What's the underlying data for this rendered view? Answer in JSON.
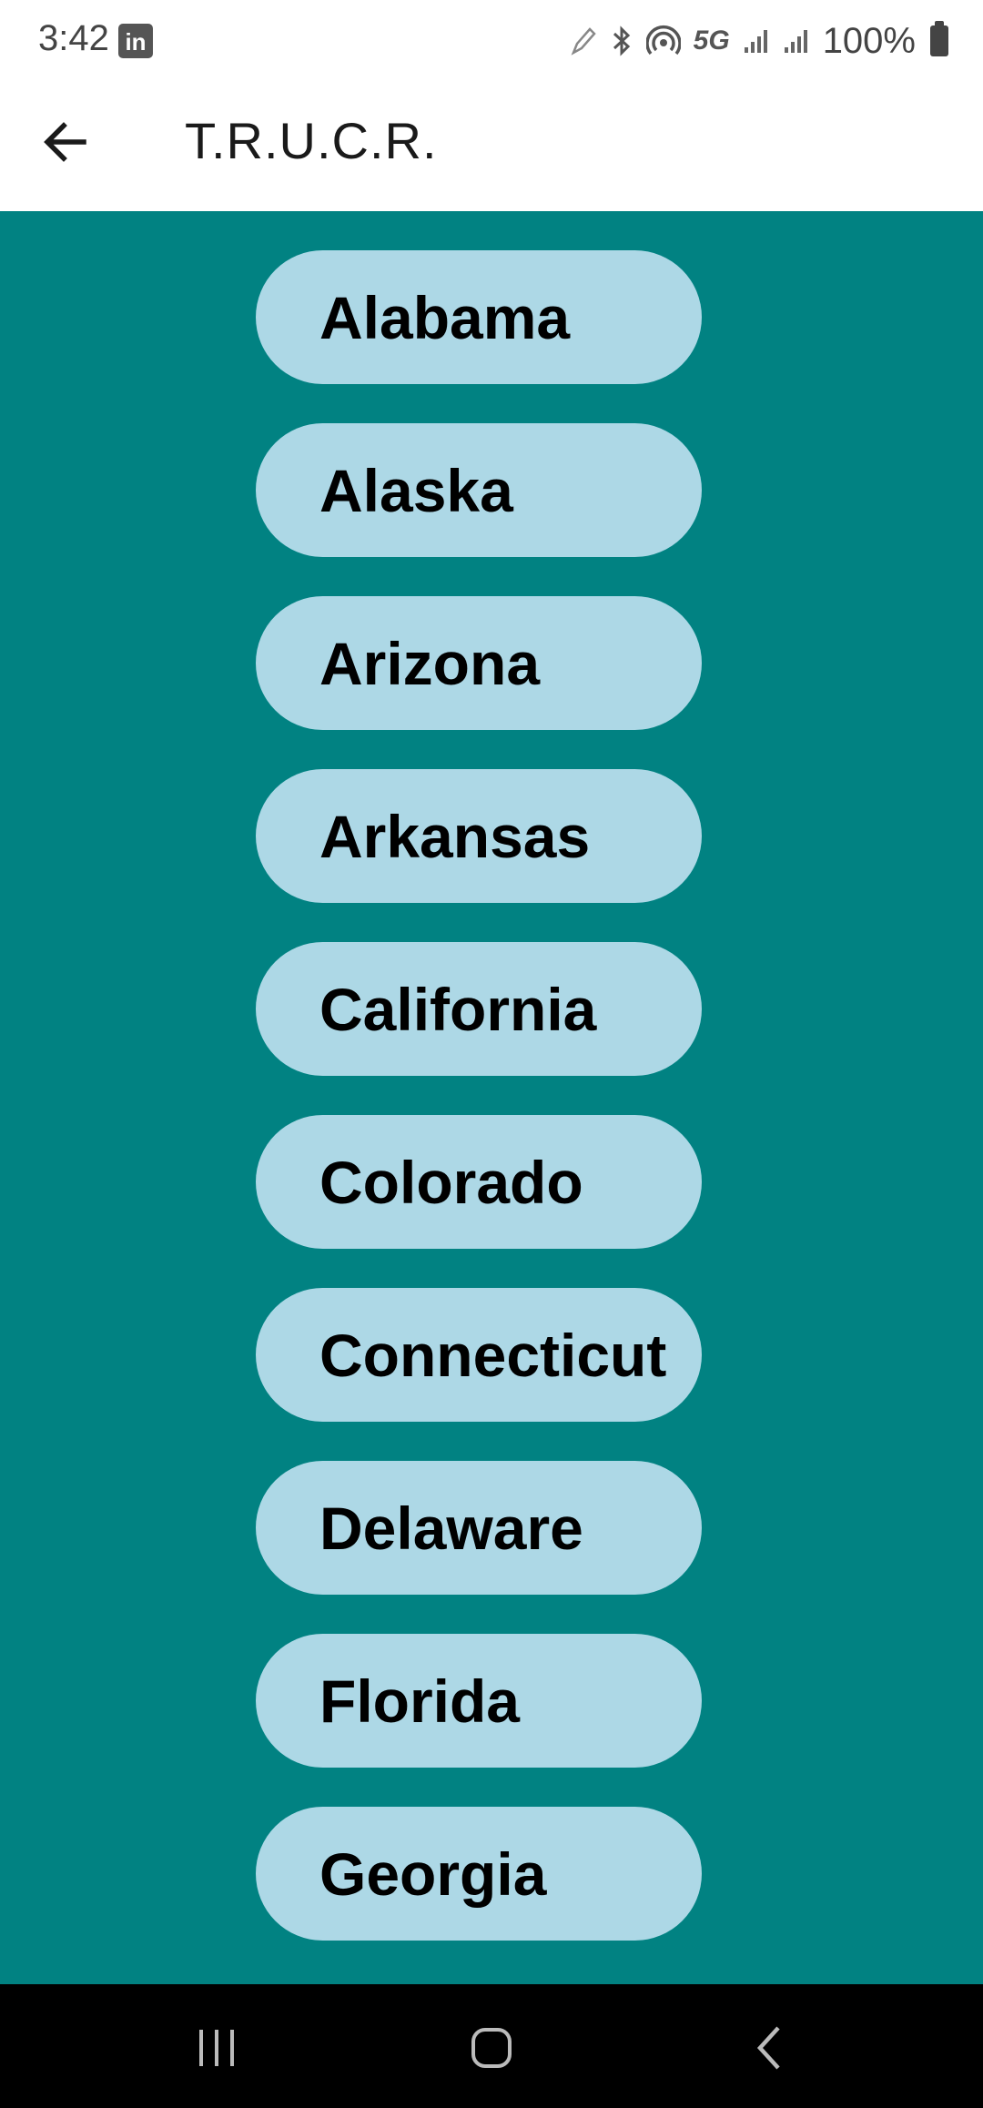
{
  "status_bar": {
    "time": "3:42",
    "notification_icon": "linkedin-icon",
    "network": "5G",
    "battery": "100%"
  },
  "app_bar": {
    "title": "T.R.U.C.R.",
    "back_icon": "arrow-left-icon"
  },
  "colors": {
    "content_background": "#018282",
    "button_background": "#add8e6",
    "button_text": "#000000",
    "nav_background": "#000000"
  },
  "states": [
    {
      "label": "Alabama"
    },
    {
      "label": "Alaska"
    },
    {
      "label": "Arizona"
    },
    {
      "label": "Arkansas"
    },
    {
      "label": "California"
    },
    {
      "label": "Colorado"
    },
    {
      "label": "Connecticut"
    },
    {
      "label": "Delaware"
    },
    {
      "label": "Florida"
    },
    {
      "label": "Georgia"
    }
  ],
  "nav_bar": {
    "recents_icon": "recents-icon",
    "home_icon": "home-icon",
    "back_icon": "back-chevron-icon"
  }
}
